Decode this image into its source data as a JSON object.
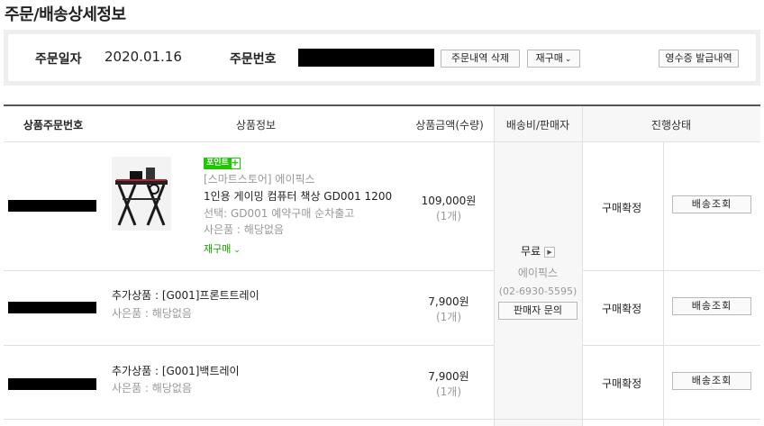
{
  "page_title": "주문/배송상세정보",
  "summary": {
    "order_date_label": "주문일자",
    "order_date": "2020.01.16",
    "order_no_label": "주문번호",
    "delete_history_btn": "주문내역 삭제",
    "reorder_btn": "재구매",
    "receipt_btn": "영수증 발급내역"
  },
  "table": {
    "headers": {
      "item_order_no": "상품주문번호",
      "product_info": "상품정보",
      "price_qty": "상품금액(수량)",
      "shipping_seller": "배송비/판매자",
      "status": "진행상태"
    },
    "rows": [
      {
        "point_tag": "포인트",
        "plus_tag": "+",
        "store": "[스마트스토어] 에이픽스",
        "name": "1인용 게이밍 컴퓨터 책상 GD001 1200",
        "option": "선택: GD001 예약구매 순차출고",
        "gift": "사은품 : 해당없음",
        "reorder": "재구매",
        "price": "109,000원",
        "qty": "(1개)",
        "status": "구매확정",
        "track_btn": "배송조회"
      },
      {
        "name": "추가상품 : [G001]프론트트레이",
        "gift": "사은품 : 해당없음",
        "price": "7,900원",
        "qty": "(1개)",
        "status": "구매확정",
        "track_btn": "배송조회"
      },
      {
        "name": "추가상품 : [G001]백트레이",
        "gift": "사은품 : 해당없음",
        "price": "7,900원",
        "qty": "(1개)",
        "status": "구매확정",
        "track_btn": "배송조회"
      }
    ],
    "shipping": {
      "fee": "무료",
      "seller": "에이픽스",
      "phone": "(02-6930-5595)",
      "inquiry_btn": "판매자 문의"
    }
  },
  "colors": {
    "accent_green": "#1ec800",
    "redaction": "#000000"
  }
}
